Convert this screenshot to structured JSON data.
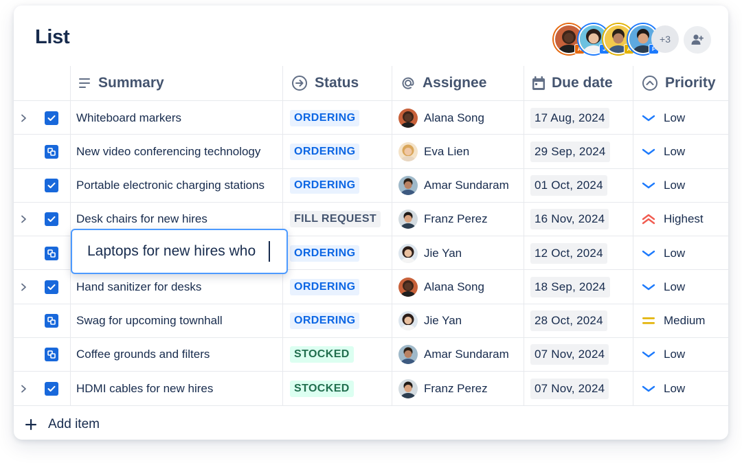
{
  "title": "List",
  "header": {
    "more_count": "+3",
    "collaborators": [
      {
        "initial": "A",
        "badge_color": "#e56910",
        "ring": "#e56910"
      },
      {
        "initial": "J",
        "badge_color": "#1d7afc",
        "ring": "#1d7afc"
      },
      {
        "initial": "A",
        "badge_color": "#e2b203",
        "ring": "#e2b203"
      },
      {
        "initial": "F",
        "badge_color": "#1d7afc",
        "ring": "#1d7afc"
      }
    ]
  },
  "columns": {
    "summary": "Summary",
    "status": "Status",
    "assignee": "Assignee",
    "due": "Due date",
    "priority": "Priority"
  },
  "rows": [
    {
      "summary": "Whiteboard markers",
      "status": "ORDERING",
      "assignee": "Alana Song",
      "due": "17 Aug, 2024",
      "priority": "Low",
      "expandable": true,
      "type": "task"
    },
    {
      "summary": "New video conferencing technology",
      "status": "ORDERING",
      "assignee": "Eva Lien",
      "due": "29 Sep, 2024",
      "priority": "Low",
      "expandable": false,
      "type": "subtask"
    },
    {
      "summary": "Portable electronic charging stations",
      "status": "ORDERING",
      "assignee": "Amar Sundaram",
      "due": "01 Oct, 2024",
      "priority": "Low",
      "expandable": false,
      "type": "task"
    },
    {
      "summary": "Desk chairs for new hires",
      "status": "FILL REQUEST",
      "assignee": "Franz Perez",
      "due": "16 Nov, 2024",
      "priority": "Highest",
      "expandable": true,
      "type": "task"
    },
    {
      "summary": "",
      "status": "ORDERING",
      "assignee": "Jie Yan",
      "due": "12 Oct, 2024",
      "priority": "Low",
      "expandable": false,
      "type": "subtask"
    },
    {
      "summary": "Hand sanitizer for desks",
      "status": "ORDERING",
      "assignee": "Alana Song",
      "due": "18 Sep, 2024",
      "priority": "Low",
      "expandable": true,
      "type": "task"
    },
    {
      "summary": "Swag for upcoming townhall",
      "status": "ORDERING",
      "assignee": "Jie Yan",
      "due": "28 Oct, 2024",
      "priority": "Medium",
      "expandable": false,
      "type": "subtask"
    },
    {
      "summary": "Coffee grounds and filters",
      "status": "STOCKED",
      "assignee": "Amar Sundaram",
      "due": "07 Nov, 2024",
      "priority": "Low",
      "expandable": false,
      "type": "subtask"
    },
    {
      "summary": "HDMI cables for new hires",
      "status": "STOCKED",
      "assignee": "Franz Perez",
      "due": "07 Nov, 2024",
      "priority": "Low",
      "expandable": true,
      "type": "task"
    }
  ],
  "editing": {
    "value": "Laptops for new hires who"
  },
  "add_item": "Add item",
  "colors": {
    "ordering": "#0c66e4",
    "stocked": "#216e4e",
    "fill_request": "#44546f",
    "priority_low": "#1d7afc",
    "priority_highest": "#f15b50",
    "priority_medium": "#e2b203"
  }
}
